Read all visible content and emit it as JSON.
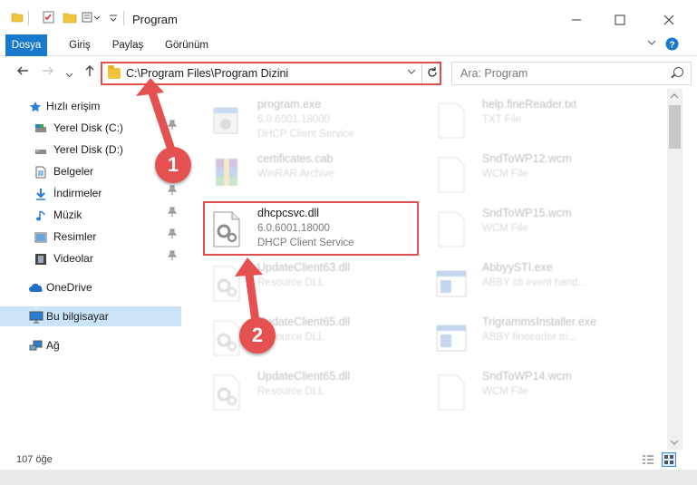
{
  "window": {
    "title": "Program"
  },
  "ribbon": {
    "tabs": [
      "Dosya",
      "Giriş",
      "Paylaş",
      "Görünüm"
    ]
  },
  "address": {
    "path": "C:\\Program Files\\Program Dizini"
  },
  "search": {
    "placeholder": "Ara: Program"
  },
  "sidebar": {
    "items": [
      {
        "label": "Hızlı erişim",
        "icon": "star-icon"
      },
      {
        "label": "Yerel Disk (C:)",
        "icon": "drive-icon",
        "pinned": true
      },
      {
        "label": "Yerel Disk (D:)",
        "icon": "drive-icon",
        "pinned": false
      },
      {
        "label": "Belgeler",
        "icon": "document-icon",
        "pinned": false
      },
      {
        "label": "İndirmeler",
        "icon": "download-icon",
        "pinned": true
      },
      {
        "label": "Müzik",
        "icon": "music-icon",
        "pinned": true
      },
      {
        "label": "Resimler",
        "icon": "pictures-icon",
        "pinned": true
      },
      {
        "label": "Videolar",
        "icon": "video-icon",
        "pinned": true
      },
      {
        "label": "OneDrive",
        "icon": "cloud-icon"
      },
      {
        "label": "Bu bilgisayar",
        "icon": "computer-icon",
        "selected": true
      },
      {
        "label": "Ağ",
        "icon": "network-icon"
      }
    ]
  },
  "files": {
    "left": [
      {
        "name": "program.exe",
        "line1": "6.0.6001.18000",
        "line2": "DHCP Client Service",
        "icon": "app-icon",
        "faded": true
      },
      {
        "name": "certificates.cab",
        "line1": "WinRAR Archive",
        "line2": "",
        "icon": "archive-icon",
        "faded": true
      },
      {
        "name": "dhcpcsvc.dll",
        "line1": "6.0.6001.18000",
        "line2": "DHCP Client Service",
        "icon": "dll-icon",
        "faded": false
      },
      {
        "name": "UpdateClient63.dll",
        "line1": "Resource DLL",
        "line2": "",
        "icon": "dll-icon",
        "faded": true
      },
      {
        "name": "UpdateClient65.dll",
        "line1": "Resource DLL",
        "line2": "",
        "icon": "dll-icon",
        "faded": true
      },
      {
        "name": "UpdateClient65.dll",
        "line1": "Resource DLL",
        "line2": "",
        "icon": "dll-icon",
        "faded": true
      }
    ],
    "right": [
      {
        "name": "help.fineReader.txt",
        "line1": "TXT File",
        "line2": "",
        "icon": "file-icon",
        "faded": true
      },
      {
        "name": "SndToWP12.wcm",
        "line1": "WCM File",
        "line2": "",
        "icon": "file-icon",
        "faded": true
      },
      {
        "name": "SndToWP15.wcm",
        "line1": "WCM File",
        "line2": "",
        "icon": "file-icon",
        "faded": true
      },
      {
        "name": "AbbyySTI.exe",
        "line1": "ABBY sti event hand...",
        "line2": "",
        "icon": "exe-icon",
        "faded": true
      },
      {
        "name": "TrigrammsInstaller.exe",
        "line1": "ABBY fineeader tri...",
        "line2": "",
        "icon": "exe-icon",
        "faded": true
      },
      {
        "name": "SndToWP14.wcm",
        "line1": "WCM File",
        "line2": "",
        "icon": "file-icon",
        "faded": true
      }
    ]
  },
  "status": {
    "count": "107 öğe"
  },
  "annotations": {
    "step1": "1",
    "step2": "2",
    "color": "#e55151"
  }
}
